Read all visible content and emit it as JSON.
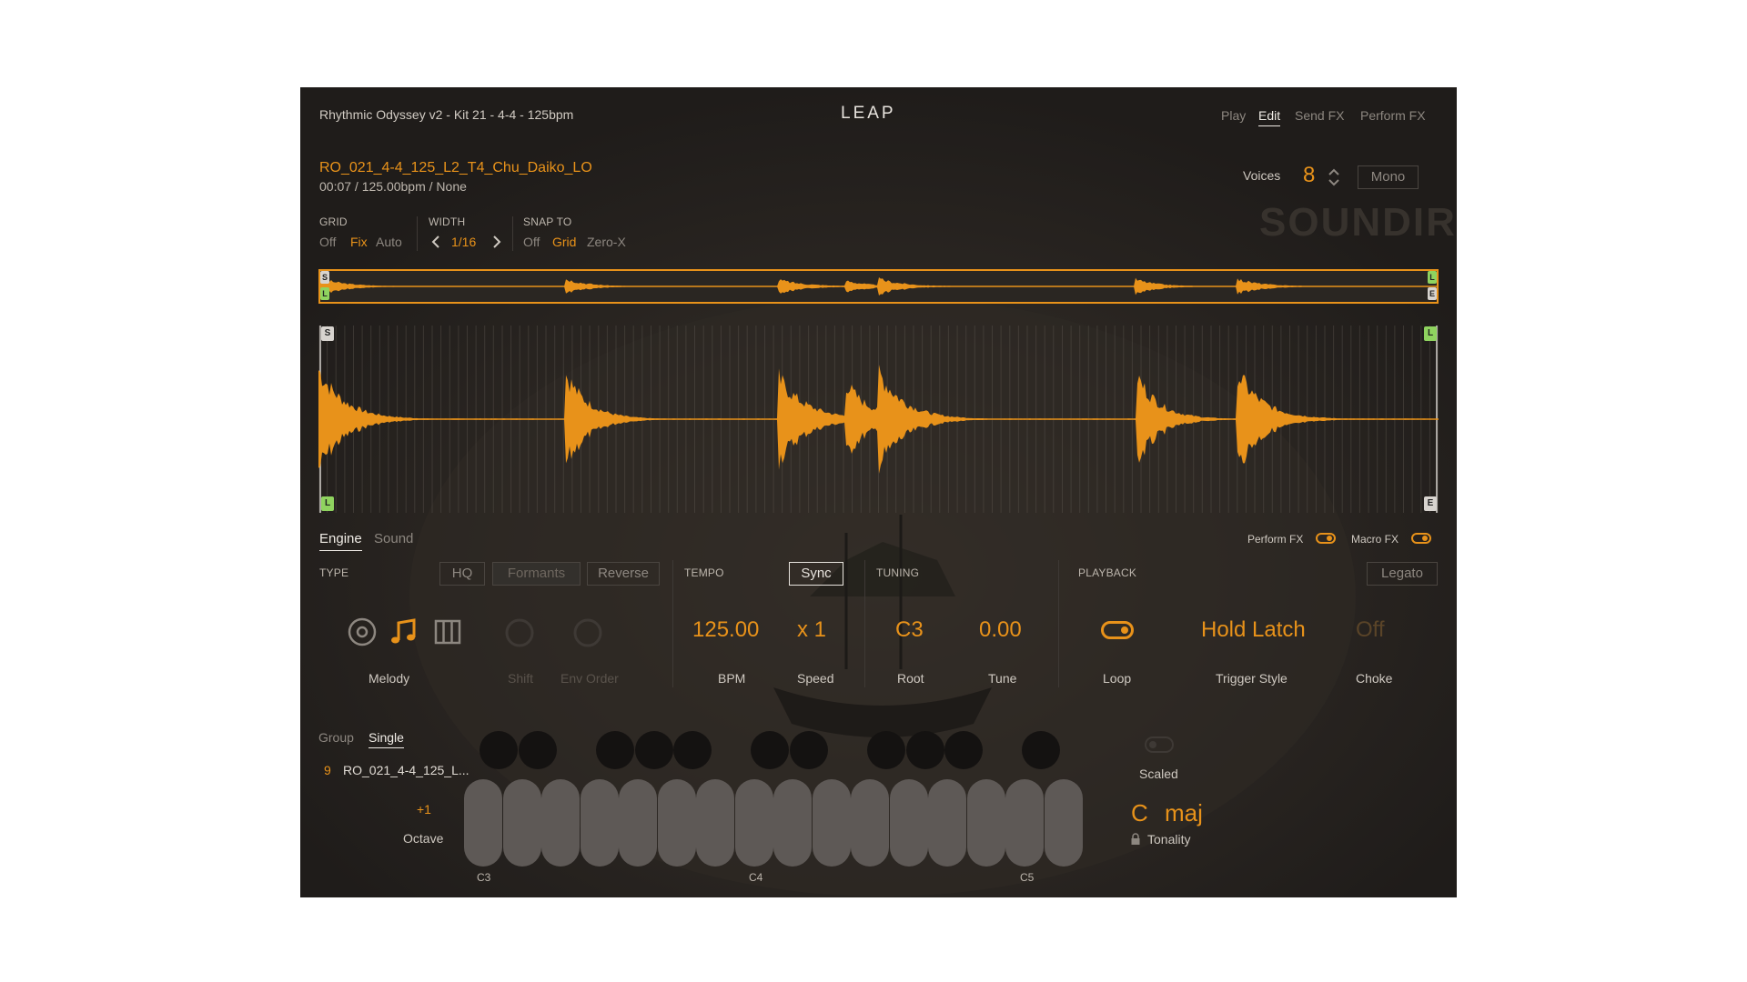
{
  "header": {
    "preset_title": "Rhythmic Odyssey v2 - Kit 21 - 4-4 - 125bpm",
    "logo": "LEAP",
    "nav": [
      "Play",
      "Edit",
      "Send FX",
      "Perform FX"
    ],
    "active_nav": "Edit"
  },
  "sample": {
    "name": "RO_021_4-4_125_L2_T4_Chu_Daiko_LO",
    "info": "00:07 / 125.00bpm / None",
    "voices_label": "Voices",
    "voices_value": "8",
    "mono_label": "Mono",
    "watermark": "SOUNDIRON"
  },
  "grid": {
    "grid_label": "GRID",
    "grid_options": [
      "Off",
      "Fix",
      "Auto"
    ],
    "grid_selected": "Fix",
    "width_label": "WIDTH",
    "width_value": "1/16",
    "snap_label": "SNAP TO",
    "snap_options": [
      "Off",
      "Grid",
      "Zero-X"
    ],
    "snap_selected": "Grid"
  },
  "waveform": {
    "markers": {
      "start": "S",
      "loop": "L",
      "end": "E"
    }
  },
  "tabs": {
    "items": [
      "Engine",
      "Sound"
    ],
    "active": "Engine",
    "perform_fx_label": "Perform FX",
    "macro_fx_label": "Macro FX",
    "perform_fx_on": true,
    "macro_fx_on": true
  },
  "engine": {
    "type_label": "TYPE",
    "type_buttons": [
      "HQ",
      "Formants",
      "Reverse"
    ],
    "type_mode": "Melody",
    "shift_label": "Shift",
    "env_order_label": "Env Order",
    "tempo_label": "TEMPO",
    "sync_label": "Sync",
    "bpm_value": "125.00",
    "bpm_label": "BPM",
    "speed_value": "x 1",
    "speed_label": "Speed",
    "tuning_label": "TUNING",
    "root_value": "C3",
    "root_label": "Root",
    "tune_value": "0.00",
    "tune_label": "Tune",
    "playback_label": "PLAYBACK",
    "legato_label": "Legato",
    "loop_label": "Loop",
    "trigger_value": "Hold Latch",
    "trigger_label": "Trigger Style",
    "choke_value": "Off",
    "choke_label": "Choke"
  },
  "keyboard": {
    "group_tabs": [
      "Group",
      "Single"
    ],
    "active_group_tab": "Single",
    "slot_number": "9",
    "slot_name": "RO_021_4-4_125_L...",
    "octave_value": "+1",
    "octave_label": "Octave",
    "key_labels": [
      "C3",
      "C4",
      "C5"
    ],
    "scaled_label": "Scaled",
    "key_root": "C",
    "key_scale": "maj",
    "tonality_label": "Tonality"
  },
  "colors": {
    "accent": "#e8921a",
    "panel": "#262321",
    "key_white": "#5e5956",
    "marker_green": "#8fd35f"
  }
}
